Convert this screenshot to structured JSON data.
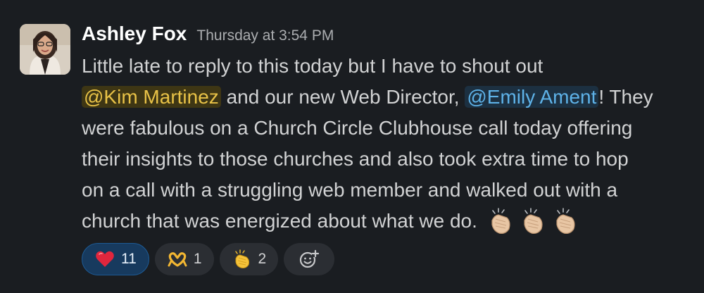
{
  "message": {
    "author": "Ashley Fox",
    "timestamp": "Thursday at 3:54 PM",
    "lines": [
      "Little late to reply to this today but I have to shout out",
      "and our new Web Director,",
      "! They",
      "were fabulous on a Church Circle Clubhouse call today offering",
      "their insights to those churches and also took extra time to hop",
      "on a call with a struggling web member and walked out with a",
      "church that was energized about what we do."
    ],
    "mentions": {
      "first": "@Kim Martinez",
      "second": "@Emily Ament"
    },
    "trailing_emoji": [
      "clap",
      "clap",
      "clap"
    ]
  },
  "reactions": [
    {
      "emoji": "heart",
      "count": "11",
      "active": true
    },
    {
      "emoji": "heart-hands",
      "count": "1",
      "active": false
    },
    {
      "emoji": "clap",
      "count": "2",
      "active": false
    }
  ],
  "colors": {
    "background": "#1a1d21",
    "self_mention_bg": "#3e3614",
    "self_mention_text": "#e8c247",
    "mention_bg": "#1c3041",
    "mention_text": "#5eb2e8",
    "active_reaction_bg": "#173a5e"
  }
}
